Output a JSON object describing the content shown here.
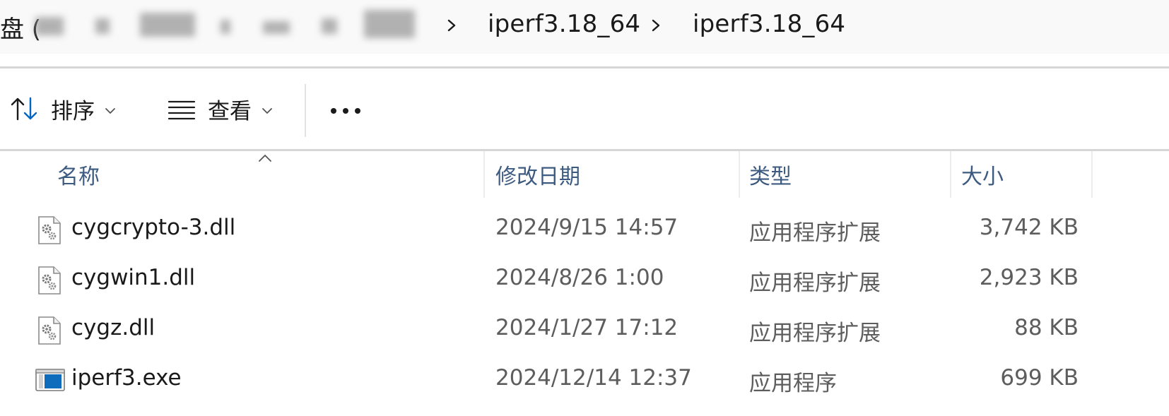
{
  "address_bar": {
    "first_crumb_text": "盘 (",
    "crumbs": [
      "iperf3.18_64",
      "iperf3.18_64"
    ],
    "separator_icon": "chevron-right-icon"
  },
  "command_bar": {
    "sort": {
      "label": "排序",
      "icon": "sort-arrows-icon"
    },
    "view": {
      "label": "查看",
      "icon": "list-view-icon"
    },
    "more": {
      "icon": "more-horizontal-icon"
    }
  },
  "columns": {
    "name": "名称",
    "modified": "修改日期",
    "type": "类型",
    "size": "大小",
    "sorted_by": "name"
  },
  "files": [
    {
      "name": "cygcrypto-3.dll",
      "modified": "2024/9/15 14:57",
      "type": "应用程序扩展",
      "size": "3,742 KB",
      "icon": "dll-gear-icon"
    },
    {
      "name": "cygwin1.dll",
      "modified": "2024/8/26 1:00",
      "type": "应用程序扩展",
      "size": "2,923 KB",
      "icon": "dll-gear-icon"
    },
    {
      "name": "cygz.dll",
      "modified": "2024/1/27 17:12",
      "type": "应用程序扩展",
      "size": "88 KB",
      "icon": "dll-gear-icon"
    },
    {
      "name": "iperf3.exe",
      "modified": "2024/12/14 12:37",
      "type": "应用程序",
      "size": "699 KB",
      "icon": "exe-window-icon"
    }
  ],
  "colors": {
    "accent": "#0067c0",
    "header_text": "#3d5a80",
    "secondary_text": "#5d5d5d"
  }
}
